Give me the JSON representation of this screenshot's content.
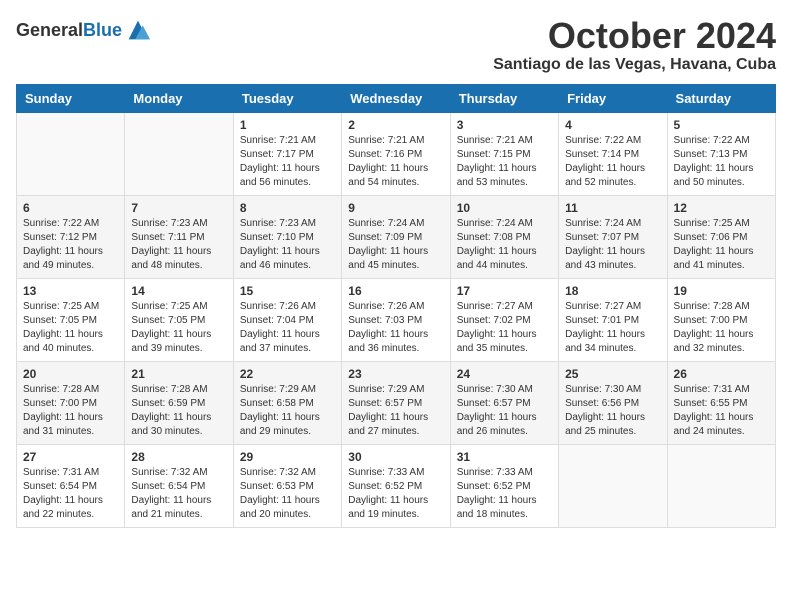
{
  "header": {
    "logo_general": "General",
    "logo_blue": "Blue",
    "month": "October 2024",
    "location": "Santiago de las Vegas, Havana, Cuba"
  },
  "days_of_week": [
    "Sunday",
    "Monday",
    "Tuesday",
    "Wednesday",
    "Thursday",
    "Friday",
    "Saturday"
  ],
  "weeks": [
    [
      {
        "day": "",
        "info": ""
      },
      {
        "day": "",
        "info": ""
      },
      {
        "day": "1",
        "info": "Sunrise: 7:21 AM\nSunset: 7:17 PM\nDaylight: 11 hours and 56 minutes."
      },
      {
        "day": "2",
        "info": "Sunrise: 7:21 AM\nSunset: 7:16 PM\nDaylight: 11 hours and 54 minutes."
      },
      {
        "day": "3",
        "info": "Sunrise: 7:21 AM\nSunset: 7:15 PM\nDaylight: 11 hours and 53 minutes."
      },
      {
        "day": "4",
        "info": "Sunrise: 7:22 AM\nSunset: 7:14 PM\nDaylight: 11 hours and 52 minutes."
      },
      {
        "day": "5",
        "info": "Sunrise: 7:22 AM\nSunset: 7:13 PM\nDaylight: 11 hours and 50 minutes."
      }
    ],
    [
      {
        "day": "6",
        "info": "Sunrise: 7:22 AM\nSunset: 7:12 PM\nDaylight: 11 hours and 49 minutes."
      },
      {
        "day": "7",
        "info": "Sunrise: 7:23 AM\nSunset: 7:11 PM\nDaylight: 11 hours and 48 minutes."
      },
      {
        "day": "8",
        "info": "Sunrise: 7:23 AM\nSunset: 7:10 PM\nDaylight: 11 hours and 46 minutes."
      },
      {
        "day": "9",
        "info": "Sunrise: 7:24 AM\nSunset: 7:09 PM\nDaylight: 11 hours and 45 minutes."
      },
      {
        "day": "10",
        "info": "Sunrise: 7:24 AM\nSunset: 7:08 PM\nDaylight: 11 hours and 44 minutes."
      },
      {
        "day": "11",
        "info": "Sunrise: 7:24 AM\nSunset: 7:07 PM\nDaylight: 11 hours and 43 minutes."
      },
      {
        "day": "12",
        "info": "Sunrise: 7:25 AM\nSunset: 7:06 PM\nDaylight: 11 hours and 41 minutes."
      }
    ],
    [
      {
        "day": "13",
        "info": "Sunrise: 7:25 AM\nSunset: 7:05 PM\nDaylight: 11 hours and 40 minutes."
      },
      {
        "day": "14",
        "info": "Sunrise: 7:25 AM\nSunset: 7:05 PM\nDaylight: 11 hours and 39 minutes."
      },
      {
        "day": "15",
        "info": "Sunrise: 7:26 AM\nSunset: 7:04 PM\nDaylight: 11 hours and 37 minutes."
      },
      {
        "day": "16",
        "info": "Sunrise: 7:26 AM\nSunset: 7:03 PM\nDaylight: 11 hours and 36 minutes."
      },
      {
        "day": "17",
        "info": "Sunrise: 7:27 AM\nSunset: 7:02 PM\nDaylight: 11 hours and 35 minutes."
      },
      {
        "day": "18",
        "info": "Sunrise: 7:27 AM\nSunset: 7:01 PM\nDaylight: 11 hours and 34 minutes."
      },
      {
        "day": "19",
        "info": "Sunrise: 7:28 AM\nSunset: 7:00 PM\nDaylight: 11 hours and 32 minutes."
      }
    ],
    [
      {
        "day": "20",
        "info": "Sunrise: 7:28 AM\nSunset: 7:00 PM\nDaylight: 11 hours and 31 minutes."
      },
      {
        "day": "21",
        "info": "Sunrise: 7:28 AM\nSunset: 6:59 PM\nDaylight: 11 hours and 30 minutes."
      },
      {
        "day": "22",
        "info": "Sunrise: 7:29 AM\nSunset: 6:58 PM\nDaylight: 11 hours and 29 minutes."
      },
      {
        "day": "23",
        "info": "Sunrise: 7:29 AM\nSunset: 6:57 PM\nDaylight: 11 hours and 27 minutes."
      },
      {
        "day": "24",
        "info": "Sunrise: 7:30 AM\nSunset: 6:57 PM\nDaylight: 11 hours and 26 minutes."
      },
      {
        "day": "25",
        "info": "Sunrise: 7:30 AM\nSunset: 6:56 PM\nDaylight: 11 hours and 25 minutes."
      },
      {
        "day": "26",
        "info": "Sunrise: 7:31 AM\nSunset: 6:55 PM\nDaylight: 11 hours and 24 minutes."
      }
    ],
    [
      {
        "day": "27",
        "info": "Sunrise: 7:31 AM\nSunset: 6:54 PM\nDaylight: 11 hours and 22 minutes."
      },
      {
        "day": "28",
        "info": "Sunrise: 7:32 AM\nSunset: 6:54 PM\nDaylight: 11 hours and 21 minutes."
      },
      {
        "day": "29",
        "info": "Sunrise: 7:32 AM\nSunset: 6:53 PM\nDaylight: 11 hours and 20 minutes."
      },
      {
        "day": "30",
        "info": "Sunrise: 7:33 AM\nSunset: 6:52 PM\nDaylight: 11 hours and 19 minutes."
      },
      {
        "day": "31",
        "info": "Sunrise: 7:33 AM\nSunset: 6:52 PM\nDaylight: 11 hours and 18 minutes."
      },
      {
        "day": "",
        "info": ""
      },
      {
        "day": "",
        "info": ""
      }
    ]
  ]
}
